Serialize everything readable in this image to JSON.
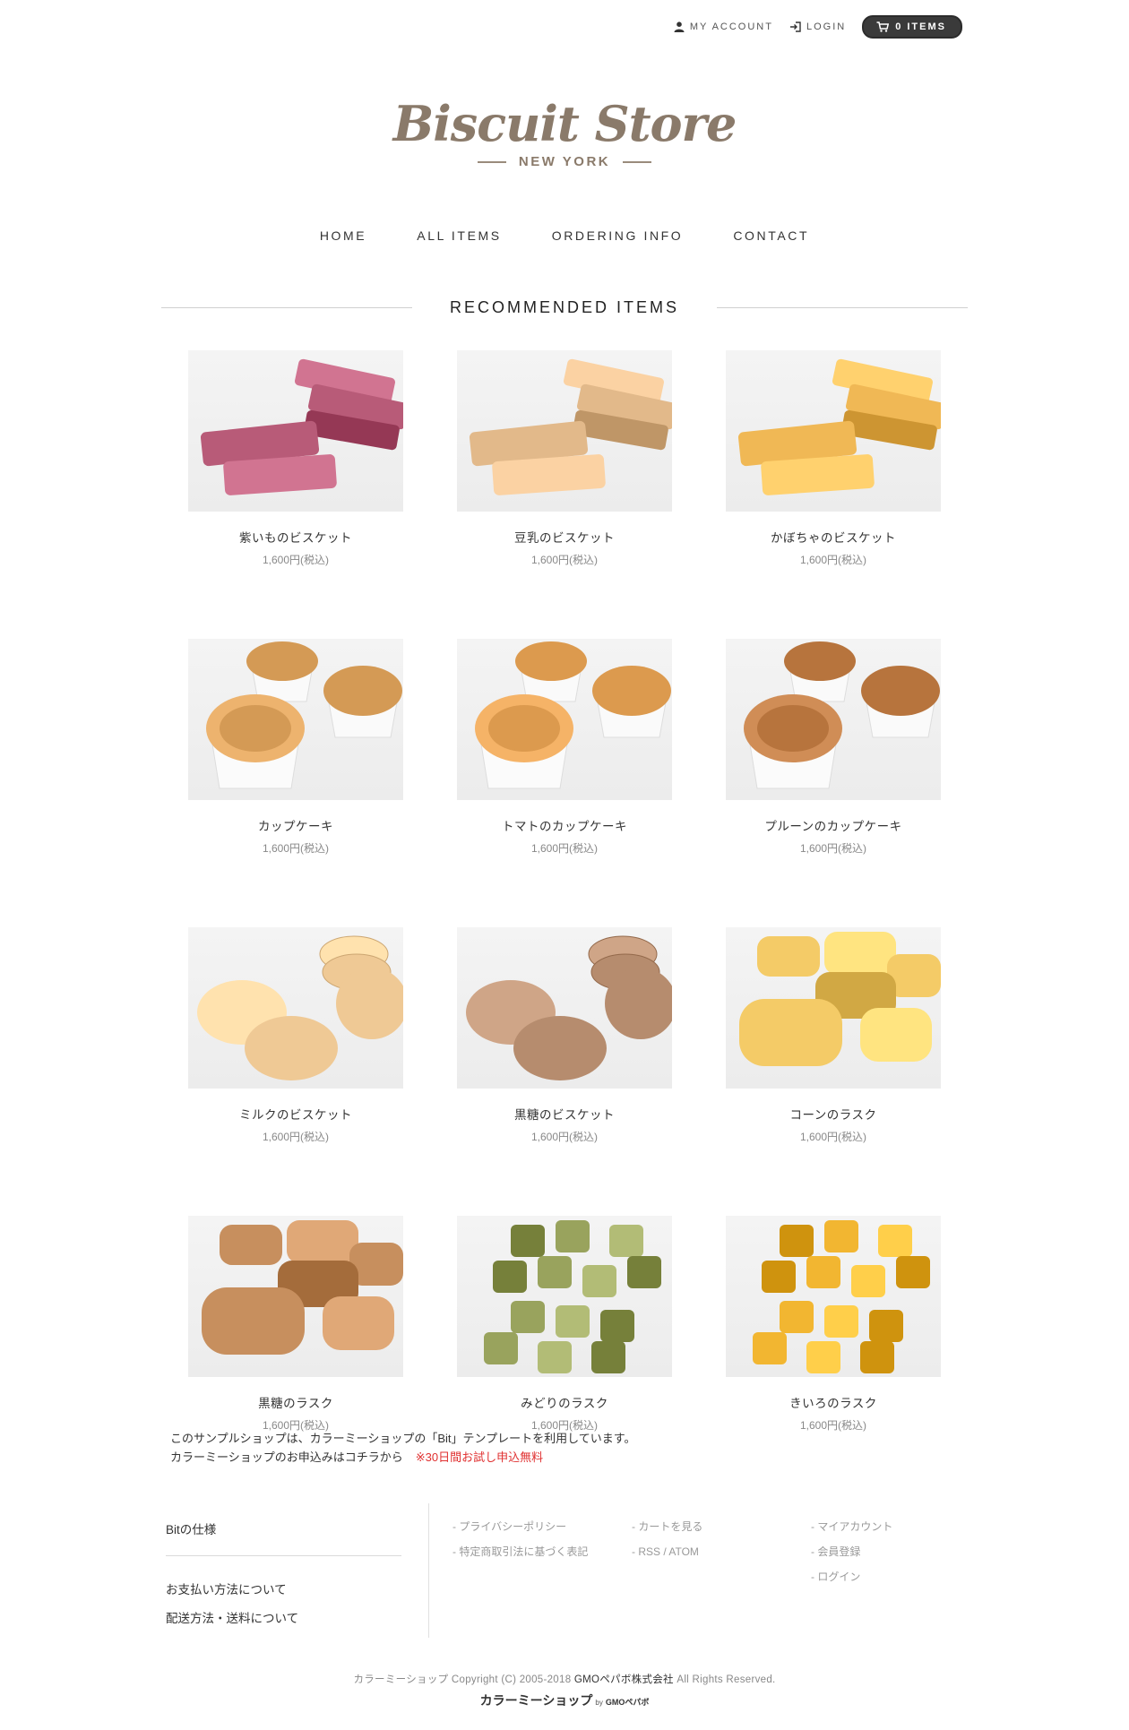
{
  "topbar": {
    "my_account": "MY ACCOUNT",
    "login": "LOGIN",
    "cart": "0 ITEMS"
  },
  "logo": {
    "name": "Biscuit Store",
    "city": "NEW YORK"
  },
  "nav": [
    "HOME",
    "ALL ITEMS",
    "ORDERING INFO",
    "CONTACT"
  ],
  "section_title": "RECOMMENDED ITEMS",
  "products": [
    {
      "name": "紫いものビスケット",
      "price": "1,600円(税込)",
      "kind": "bar",
      "color": "#b85b78"
    },
    {
      "name": "豆乳のビスケット",
      "price": "1,600円(税込)",
      "kind": "bar",
      "color": "#e2b98a"
    },
    {
      "name": "かぼちゃのビスケット",
      "price": "1,600円(税込)",
      "kind": "bar",
      "color": "#f0b855"
    },
    {
      "name": "カップケーキ",
      "price": "1,600円(税込)",
      "kind": "cup",
      "color": "#d49a55"
    },
    {
      "name": "トマトのカップケーキ",
      "price": "1,600円(税込)",
      "kind": "cup",
      "color": "#dc9a4e"
    },
    {
      "name": "プルーンのカップケーキ",
      "price": "1,600円(税込)",
      "kind": "cup",
      "color": "#b7743d"
    },
    {
      "name": "ミルクのビスケット",
      "price": "1,600円(税込)",
      "kind": "round",
      "color": "#efc995"
    },
    {
      "name": "黒糖のビスケット",
      "price": "1,600円(税込)",
      "kind": "round",
      "color": "#b68c6e"
    },
    {
      "name": "コーンのラスク",
      "price": "1,600円(税込)",
      "kind": "rusk",
      "color": "#f4cb67"
    },
    {
      "name": "黒糖のラスク",
      "price": "1,600円(税込)",
      "kind": "rusk",
      "color": "#c78f5e"
    },
    {
      "name": "みどりのラスク",
      "price": "1,600円(税込)",
      "kind": "cube",
      "color": "#99a35d"
    },
    {
      "name": "きいろのラスク",
      "price": "1,600円(税込)",
      "kind": "cube",
      "color": "#f2b631"
    }
  ],
  "notice": {
    "line1": "このサンプルショップは、カラーミーショップの「Bit」テンプレートを利用しています。",
    "line2": "カラーミーショップのお申込みはコチラから",
    "highlight": "※30日間お試し申込無料"
  },
  "footer": {
    "left_title": "Bitの仕様",
    "left_links": [
      "お支払い方法について",
      "配送方法・送料について"
    ],
    "col1": [
      "- プライバシーポリシー",
      "- 特定商取引法に基づく表記"
    ],
    "col2": [
      "- カートを見る",
      "- RSS / ATOM"
    ],
    "col3": [
      "- マイアカウント",
      "- 会員登録",
      "- ログイン"
    ],
    "copyright_pre": "カラーミーショップ Copyright (C) 2005-2018",
    "copyright_company": "GMOペパボ株式会社",
    "copyright_post": "All Rights Reserved.",
    "brand": "カラーミーショップ",
    "brand_by": "by",
    "brand_gmo": "GMOペパボ"
  }
}
